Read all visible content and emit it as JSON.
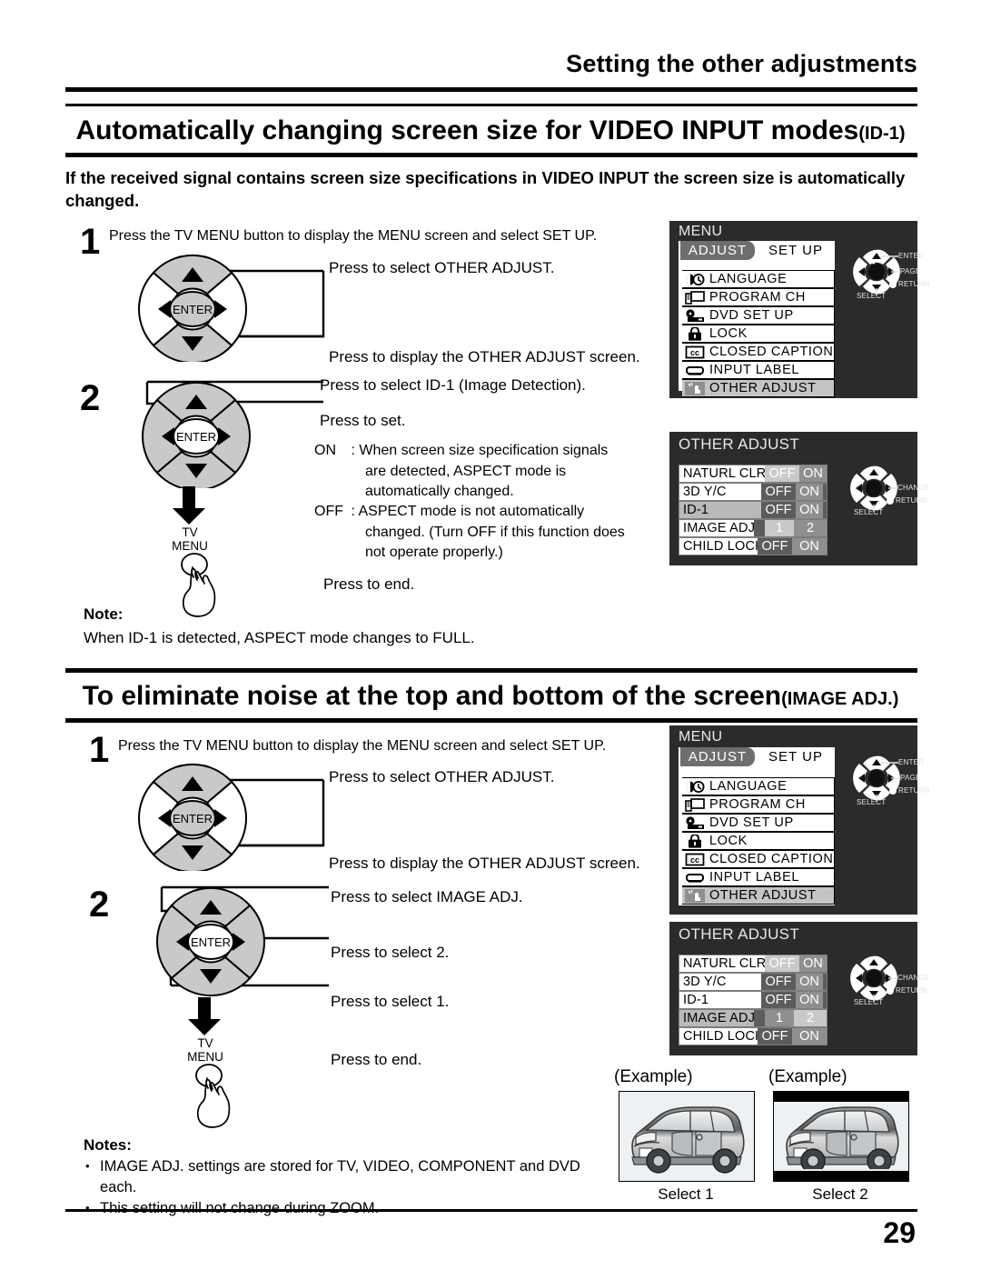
{
  "page": {
    "running_head": "Setting the other adjustments",
    "page_number": "29"
  },
  "sections": [
    {
      "title": "Automatically changing screen size for VIDEO INPUT modes",
      "title_suffix": "(ID-1)",
      "intro": "If the received signal contains screen size specifications in VIDEO INPUT the screen size is automatically changed.",
      "step1": {
        "number": "1",
        "text": "Press the TV MENU button to display the MENU screen and select SET UP.",
        "callout_up": "Press to select OTHER ADJUST.",
        "callout_down": "Press to display the OTHER ADJUST screen."
      },
      "step2": {
        "number": "2",
        "callout_up": "Press to select ID-1 (Image Detection).",
        "callout_right": "Press to set.",
        "on_label": "ON",
        "on_colon": ":",
        "on_text_line1": "When screen size specification signals",
        "on_text_line2": "are detected, ASPECT mode is",
        "on_text_line3": "automatically changed.",
        "off_label": "OFF",
        "off_colon": ":",
        "off_text_line1": "ASPECT mode is not automatically",
        "off_text_line2": "changed. (Turn OFF if this function does",
        "off_text_line3": "not operate properly.)",
        "callout_end": "Press to end.",
        "tv_menu_line1": "TV",
        "tv_menu_line2": "MENU"
      },
      "note_heading": "Note:",
      "note_body": "When ID-1 is detected, ASPECT mode changes to FULL."
    },
    {
      "title": "To eliminate noise at the top and bottom of the screen",
      "title_suffix": "(IMAGE ADJ.)",
      "step1": {
        "number": "1",
        "text": "Press the TV MENU button to display the MENU screen and select SET UP.",
        "callout_up": "Press to select OTHER ADJUST.",
        "callout_down": "Press to display the OTHER ADJUST screen."
      },
      "step2": {
        "number": "2",
        "callout_up": "Press to select IMAGE ADJ.",
        "callout_right": "Press to select 2.",
        "callout_down": "Press to select 1.",
        "callout_end": "Press to end.",
        "tv_menu_line1": "TV",
        "tv_menu_line2": "MENU"
      },
      "notes_heading": "Notes:",
      "notes": [
        "IMAGE ADJ. settings are stored for TV, VIDEO, COMPONENT and DVD each.",
        "This setting will not change during ZOOM."
      ]
    }
  ],
  "menu_osd": {
    "title": "MENU",
    "tabs": [
      {
        "label": "ADJUST",
        "active": false
      },
      {
        "label": "SET  UP",
        "active": true
      }
    ],
    "items": [
      {
        "label": "LANGUAGE",
        "icon": "language-icon",
        "selected": false
      },
      {
        "label": "PROGRAM  CH",
        "icon": "program-ch-icon",
        "selected": false
      },
      {
        "label": "DVD  SET  UP",
        "icon": "dvd-setup-icon",
        "selected": false
      },
      {
        "label": "LOCK",
        "icon": "lock-icon",
        "selected": false
      },
      {
        "label": "CLOSED CAPTION",
        "icon": "closed-caption-icon",
        "selected": false
      },
      {
        "label": "INPUT  LABEL",
        "icon": "input-label-icon",
        "selected": false
      },
      {
        "label": "OTHER  ADJUST",
        "icon": "other-adjust-icon",
        "selected": true
      }
    ],
    "nav": {
      "up": "ENTER",
      "right": "PAGE",
      "return": "RETURN",
      "down": "SELECT"
    }
  },
  "other_adjust_osd_1": {
    "title": "OTHER ADJUST",
    "rows": [
      {
        "label": "NATURL CLR",
        "options": [
          "OFF",
          "ON"
        ],
        "selected_option": "OFF",
        "row_selected": false
      },
      {
        "label": "3D Y/C",
        "options": [
          "OFF",
          "ON"
        ],
        "selected_option": "ON",
        "row_selected": false
      },
      {
        "label": "ID-1",
        "options": [
          "OFF",
          "ON"
        ],
        "selected_option": "ON",
        "row_selected": true
      },
      {
        "label": "IMAGE ADJ.",
        "options": [
          "1",
          "2"
        ],
        "selected_option": "1",
        "row_selected": false
      },
      {
        "label": "CHILD LOCK",
        "options": [
          "OFF",
          "ON"
        ],
        "selected_option": "OFF",
        "row_selected": false
      }
    ],
    "nav": {
      "right": "CHANGE",
      "return": "RETURN",
      "down": "SELECT"
    }
  },
  "other_adjust_osd_2": {
    "title": "OTHER ADJUST",
    "rows": [
      {
        "label": "NATURL CLR",
        "options": [
          "OFF",
          "ON"
        ],
        "selected_option": "OFF",
        "row_selected": false
      },
      {
        "label": "3D Y/C",
        "options": [
          "OFF",
          "ON"
        ],
        "selected_option": "ON",
        "row_selected": false
      },
      {
        "label": "ID-1",
        "options": [
          "OFF",
          "ON"
        ],
        "selected_option": "ON",
        "row_selected": false
      },
      {
        "label": "IMAGE ADJ.",
        "options": [
          "1",
          "2"
        ],
        "selected_option": "2",
        "row_selected": true
      },
      {
        "label": "CHILD LOCK",
        "options": [
          "OFF",
          "ON"
        ],
        "selected_option": "OFF",
        "row_selected": false
      }
    ],
    "nav": {
      "right": "CHANGE",
      "return": "RETURN",
      "down": "SELECT"
    }
  },
  "examples": [
    {
      "heading": "(Example)",
      "caption": "Select 1",
      "letterboxed": false
    },
    {
      "heading": "(Example)",
      "caption": "Select 2",
      "letterboxed": true
    }
  ],
  "pad_label": "ENTER",
  "colors": {
    "ink": "#000000",
    "osd_background": "#2b2b2b",
    "osd_panel": "#ffffff",
    "selected_row": "#c4c4c4",
    "segment_dark": "#5c5c5c",
    "segment_mid": "#8f8f8f",
    "pad_fill": "#c9c9c9"
  }
}
